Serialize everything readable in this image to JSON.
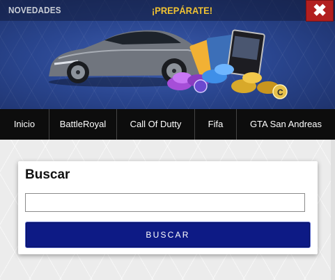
{
  "banner": {
    "tag": "NOVEDADES",
    "headline": "¡PREPÁRATE!",
    "close_label": "✖"
  },
  "nav": {
    "items": [
      {
        "label": "Inicio"
      },
      {
        "label": "BattleRoyal"
      },
      {
        "label": "Call Of Dutty"
      },
      {
        "label": "Fifa"
      },
      {
        "label": "GTA San Andreas"
      }
    ]
  },
  "search": {
    "title": "Buscar",
    "input_value": "",
    "button_label": "BUSCAR"
  },
  "colors": {
    "nav_bg": "#0d0d0d",
    "button_bg": "#0d1a85",
    "close_bg": "#b21f1f",
    "headline": "#f1c232"
  },
  "icons": {
    "close": "close-icon"
  }
}
